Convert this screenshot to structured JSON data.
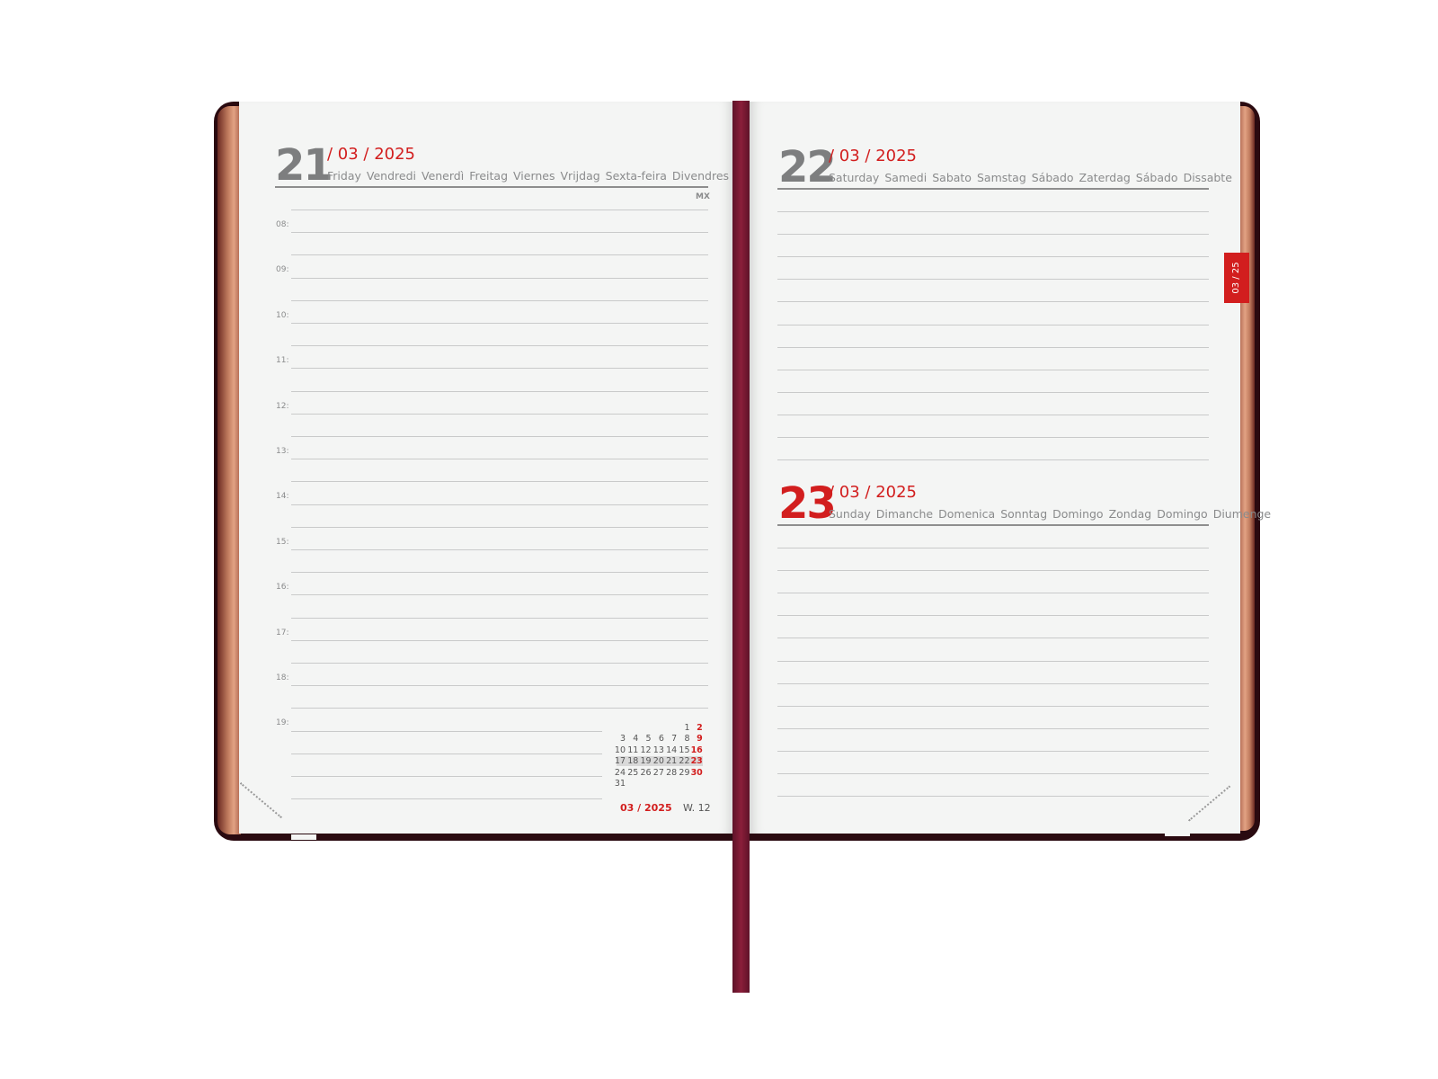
{
  "left_page": {
    "day": "21",
    "month_year": "/ 03 / 2025",
    "weekdays": [
      "Friday",
      "Vendredi",
      "Venerdì",
      "Freitag",
      "Viernes",
      "Vrijdag",
      "Sexta-feira",
      "Divendres"
    ],
    "mx_label": "MX",
    "hours": [
      "08:",
      "09:",
      "10:",
      "11:",
      "12:",
      "13:",
      "14:",
      "15:",
      "16:",
      "17:",
      "18:",
      "19:"
    ],
    "mini_calendar": {
      "rows": [
        [
          "",
          "",
          "",
          "",
          "",
          "1",
          "2"
        ],
        [
          "3",
          "4",
          "5",
          "6",
          "7",
          "8",
          "9"
        ],
        [
          "10",
          "11",
          "12",
          "13",
          "14",
          "15",
          "16"
        ],
        [
          "17",
          "18",
          "19",
          "20",
          "21",
          "22",
          "23"
        ],
        [
          "24",
          "25",
          "26",
          "27",
          "28",
          "29",
          "30"
        ],
        [
          "31",
          "",
          "",
          "",
          "",
          "",
          ""
        ]
      ]
    },
    "footer_month": "03 / 2025",
    "footer_week": "W. 12"
  },
  "right_page": {
    "top": {
      "day": "22",
      "month_year": "/ 03 / 2025",
      "weekdays": [
        "Saturday",
        "Samedi",
        "Sabato",
        "Samstag",
        "Sábado",
        "Zaterdag",
        "Sábado",
        "Dissabte"
      ]
    },
    "bottom": {
      "day": "23",
      "month_year": "/ 03 / 2025",
      "weekdays": [
        "Sunday",
        "Dimanche",
        "Domenica",
        "Sonntag",
        "Domingo",
        "Zondag",
        "Domingo",
        "Diumenge"
      ]
    },
    "tab_label": "03 / 25"
  },
  "colors": {
    "accent_red": "#d21e1e",
    "cover": "#2a0a10",
    "ribbon": "#8a1e3a",
    "paper": "#f4f5f4"
  }
}
